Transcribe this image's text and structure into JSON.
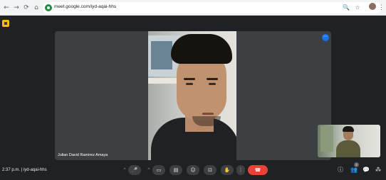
{
  "browser": {
    "url": "meet.google.com/iyd-aqai-hhs",
    "icons": {
      "back": "←",
      "forward": "→",
      "reload": "⟳",
      "home": "⌂",
      "zoom": "🔍",
      "star": "☆",
      "menu": "⋮"
    }
  },
  "meeting": {
    "participant_name": "Julian David Ramirez Amaya",
    "tile_menu_icon": "⋯",
    "self_name": "",
    "time": "2:37 p.m.",
    "separator": "|",
    "code": "iyd-aqai-hhs",
    "participant_count": "2"
  },
  "controls": {
    "mic_options": "⌃",
    "mic": "🎤",
    "cam_options": "⌃",
    "camera": "▭",
    "captions": "▤",
    "emoji": "☺",
    "present": "⊡",
    "raise_hand": "✋",
    "more": "⋮",
    "end_call": "☎",
    "info": "ⓘ",
    "people": "👥",
    "chat": "💬",
    "activities": "⁂"
  },
  "colors": {
    "end_call": "#ea4335",
    "accent": "#1a73e8",
    "background": "#202124",
    "tile": "#3c4043"
  }
}
